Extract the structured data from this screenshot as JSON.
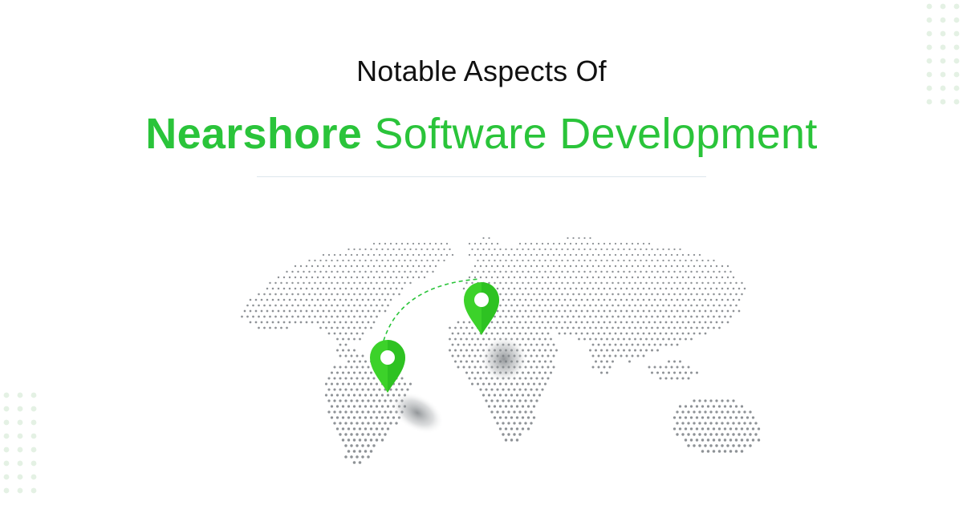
{
  "header": {
    "line1": "Notable Aspects Of",
    "title_strong": "Nearshore",
    "title_rest": "Software Development"
  },
  "colors": {
    "accent": "#2ac43a",
    "map_dots": "#8e9296",
    "decor_dots": "#e4f1e4",
    "headline": "#111111"
  },
  "map": {
    "markers": [
      "location-pin-icon",
      "location-pin-icon"
    ],
    "connector": "dashed-arc"
  }
}
